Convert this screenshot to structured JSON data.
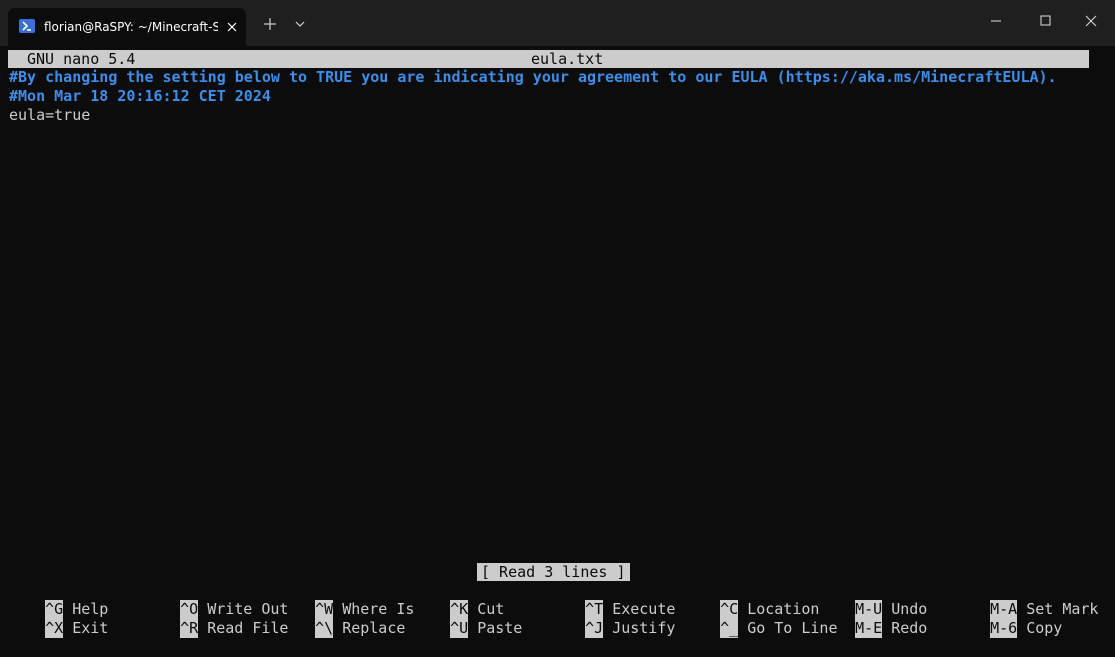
{
  "window": {
    "tab_title": "florian@RaSPY: ~/Minecraft-Server",
    "tab_icon": "powershell-icon",
    "accent": "#3b6fd6",
    "background": "#0c0c0c",
    "titlebar_bg": "#1f1f1f"
  },
  "nano": {
    "version": "GNU nano 5.4",
    "filename": "eula.txt",
    "lines": [
      "#By changing the setting below to TRUE you are indicating your agreement to our EULA (https://aka.ms/MinecraftEULA).",
      "#Mon Mar 18 20:16:12 CET 2024",
      "eula=true"
    ],
    "status": "[ Read 3 lines ]",
    "shortcuts": [
      {
        "key": "^G",
        "label": "Help"
      },
      {
        "key": "^X",
        "label": "Exit"
      },
      {
        "key": "^O",
        "label": "Write Out"
      },
      {
        "key": "^R",
        "label": "Read File"
      },
      {
        "key": "^W",
        "label": "Where Is"
      },
      {
        "key": "^\\",
        "label": "Replace"
      },
      {
        "key": "^K",
        "label": "Cut"
      },
      {
        "key": "^U",
        "label": "Paste"
      },
      {
        "key": "^T",
        "label": "Execute"
      },
      {
        "key": "^J",
        "label": "Justify"
      },
      {
        "key": "^C",
        "label": "Location"
      },
      {
        "key": "^_",
        "label": "Go To Line"
      },
      {
        "key": "M-U",
        "label": "Undo"
      },
      {
        "key": "M-E",
        "label": "Redo"
      },
      {
        "key": "M-A",
        "label": "Set Mark"
      },
      {
        "key": "M-6",
        "label": "Copy"
      }
    ],
    "comment_color": "#3b8eea",
    "text_color": "#cccccc"
  }
}
